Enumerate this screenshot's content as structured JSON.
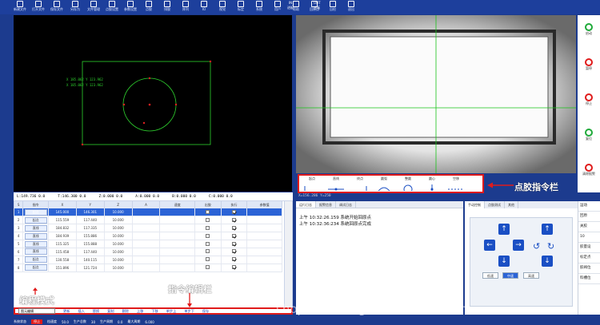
{
  "toolbar": {
    "items": [
      "新建文件",
      "打开文件",
      "保存文件",
      "另存为",
      "文件管理",
      "点胶设置",
      "参数设置",
      "点胶",
      "排胶",
      "阵列",
      "IO",
      "视觉",
      "标定",
      "系统",
      "用户",
      "帮助",
      "回原点",
      "自检",
      "退出"
    ],
    "in_label": "IN",
    "in_sub": "进板",
    "out_label": "OUT",
    "out_sub": "出板"
  },
  "left_view": {
    "overlay_line1": "X 185.062 Y 123.962",
    "overlay_line2": "X 185.062 Y 123.962"
  },
  "coords": [
    "L:149.736 0.0",
    "T:146.300 0.0",
    "Z:0.000 0.0",
    "A:0.000 0.0",
    "B:0.000 0.0",
    "C:0.000 0.0"
  ],
  "table": {
    "headers": [
      "S",
      "指令",
      "X",
      "Y",
      "Z",
      "A",
      "速度",
      "出胶",
      "执行",
      "参数值"
    ],
    "rows": [
      {
        "n": "1",
        "cmd": "起点",
        "x": "145.000",
        "y": "146.301",
        "z": "10.000",
        "glue": false,
        "exec": true
      },
      {
        "n": "2",
        "cmd": "起点",
        "x": "115.559",
        "y": "117.440",
        "z": "10.000",
        "glue": false,
        "exec": true
      },
      {
        "n": "3",
        "cmd": "直线",
        "x": "184.832",
        "y": "117.335",
        "z": "10.000",
        "glue": false,
        "exec": true
      },
      {
        "n": "4",
        "cmd": "直线",
        "x": "184.939",
        "y": "155.886",
        "z": "10.000",
        "glue": false,
        "exec": true
      },
      {
        "n": "5",
        "cmd": "直线",
        "x": "115.325",
        "y": "155.888",
        "z": "10.000",
        "glue": false,
        "exec": true
      },
      {
        "n": "6",
        "cmd": "直线",
        "x": "115.458",
        "y": "117.440",
        "z": "10.000",
        "glue": false,
        "exec": true
      },
      {
        "n": "7",
        "cmd": "起点",
        "x": "130.558",
        "y": "140.115",
        "z": "10.000",
        "glue": false,
        "exec": true
      },
      {
        "n": "8",
        "cmd": "起点",
        "x": "151.896",
        "y": "121.724",
        "z": "10.000",
        "glue": false,
        "exec": true
      }
    ]
  },
  "cmdbar": {
    "mode": "图元编辑",
    "buttons": [
      "更新",
      "插入",
      "替换",
      "复制",
      "删除",
      "上移",
      "下移",
      "单步上",
      "单步下",
      "保存"
    ]
  },
  "status": {
    "items": [
      "系统状态",
      "停止",
      "档速度",
      "50.0",
      "生产总数",
      "30",
      "生产周期",
      "0.0",
      "最大周期",
      "6.000"
    ]
  },
  "glue_bar": {
    "buttons": [
      "起点",
      "直线",
      "终点",
      "圆弧",
      "整圆",
      "圆心",
      "空移"
    ],
    "label": "点胶指令栏"
  },
  "xy_readout": "X=156.286 Y=250",
  "log": {
    "tabs": [
      "运行日志",
      "报警信息",
      "调试日志"
    ],
    "lines": [
      "上午 10:32:26.159 系统开始回原点",
      "上午 10:32:36:234 系统回原点完成"
    ]
  },
  "jog": {
    "tabs": [
      "手动控制",
      "点胶测试",
      "其他"
    ],
    "low": "低速",
    "mid": "中速",
    "high": "高速"
  },
  "side_buttons": [
    "启动",
    "暂停",
    "停止",
    "复位",
    "清除报警"
  ],
  "side2": [
    "运动",
    "回原",
    "关胶",
    "10",
    "胶量设",
    "标定点",
    "胶阀位",
    "料槽位"
  ],
  "annotations": {
    "mode": "编程模式",
    "cmd": "指令编辑栏"
  },
  "watermark": "shop4164254gk1929.1688.com"
}
